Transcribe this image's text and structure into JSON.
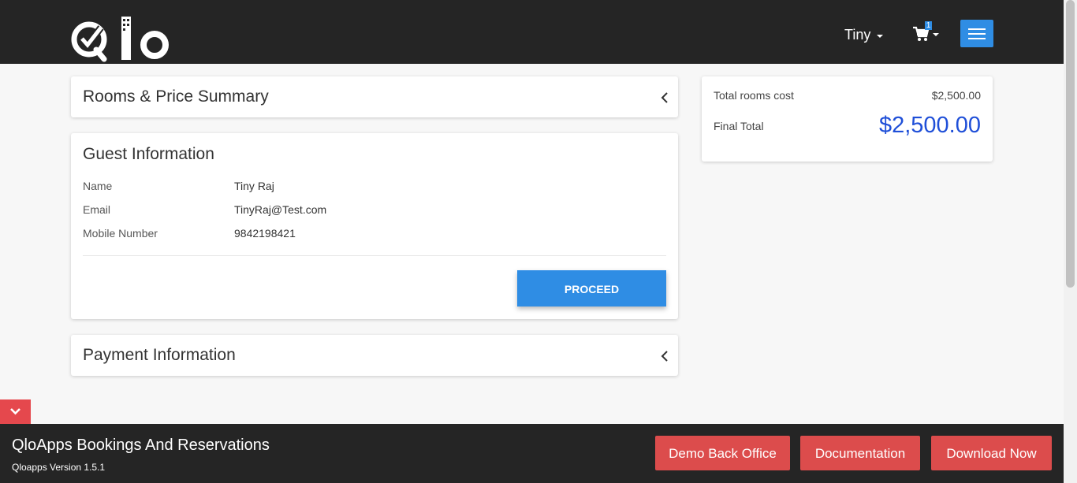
{
  "header": {
    "logo_alt": "Qlo",
    "user_name": "Tiny",
    "cart_count": "1"
  },
  "rooms_summary": {
    "title": "Rooms & Price Summary"
  },
  "guest_info": {
    "title": "Guest Information",
    "rows": [
      {
        "label": "Name",
        "value": "Tiny Raj"
      },
      {
        "label": "Email",
        "value": "TinyRaj@Test.com"
      },
      {
        "label": "Mobile Number",
        "value": "9842198421"
      }
    ],
    "proceed_label": "PROCEED"
  },
  "payment_info": {
    "title": "Payment Information"
  },
  "summary": {
    "total_rooms_label": "Total rooms cost",
    "total_rooms_value": "$2,500.00",
    "final_total_label": "Final Total",
    "final_total_value": "$2,500.00"
  },
  "footer": {
    "title": "QloApps Bookings And Reservations",
    "version": "Qloapps Version 1.5.1",
    "buttons": [
      "Demo Back Office",
      "Documentation",
      "Download Now"
    ]
  },
  "colors": {
    "header_bg": "#252525",
    "accent_blue": "#2f8de4",
    "price_blue": "#1f4fd8",
    "footer_button": "#dc4c4c"
  }
}
